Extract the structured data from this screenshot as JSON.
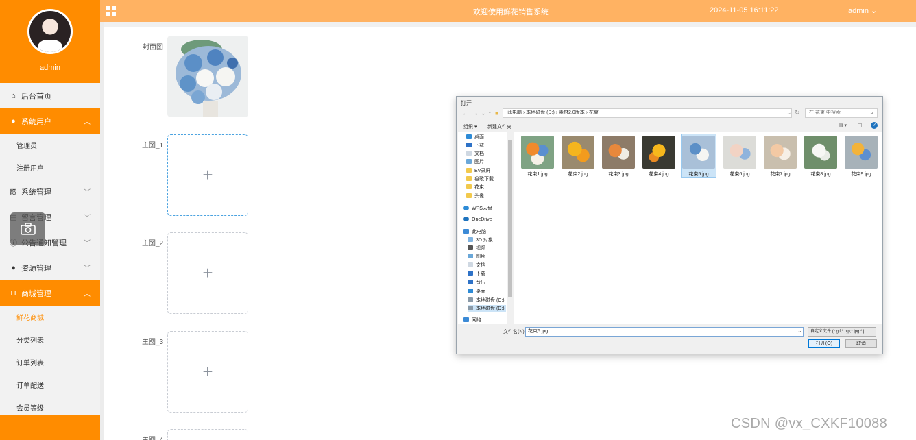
{
  "sidebar": {
    "username": "admin",
    "menu": {
      "home": "后台首页",
      "system_users": "系统用户",
      "admins": "管理员",
      "registered_users": "注册用户",
      "system_mgmt": "系统管理",
      "message_mgmt": "留言管理",
      "notice_mgmt": "公告通知管理",
      "resource_mgmt": "资源管理",
      "mall_mgmt": "商城管理",
      "flower_mall": "鲜花商城",
      "category_list": "分类列表",
      "order_list": "订单列表",
      "order_delivery": "订单配送",
      "member_level": "会员等级"
    }
  },
  "header": {
    "title": "欢迎使用鲜花销售系统",
    "datetime": "2024-11-05 16:11:22",
    "user": "admin"
  },
  "form": {
    "cover_label": "封面图",
    "main1_label": "主图_1",
    "main2_label": "主图_2",
    "main3_label": "主图_3",
    "main4_label": "主图_4",
    "plus": "+"
  },
  "dialog": {
    "title": "打开",
    "address": "此电脑 › 本地磁盘 (D:) › 素材2.0版本 › 花束",
    "search_placeholder": "在 花束 中搜索",
    "organize": "组织 ▾",
    "new_folder": "新建文件夹",
    "nav": {
      "desktop": "桌面",
      "downloads": "下载",
      "documents": "文档",
      "pictures": "图片",
      "ev_recordings": "EV录屏",
      "chrome_downloads": "谷歌下载",
      "bouquet": "花束",
      "avatar": "头像",
      "wps_cloud": "WPS云盘",
      "onedrive": "OneDrive",
      "this_pc": "此电脑",
      "objects_3d": "3D 对象",
      "videos": "视频",
      "pictures2": "图片",
      "documents2": "文档",
      "downloads2": "下载",
      "music": "音乐",
      "desktop2": "桌面",
      "disk_c": "本地磁盘 (C:)",
      "disk_d": "本地磁盘 (D:)",
      "network": "网络"
    },
    "files": [
      "花束1.jpg",
      "花束2.jpg",
      "花束3.jpg",
      "花束4.jpg",
      "花束5.jpg",
      "花束6.jpg",
      "花束7.jpg",
      "花束8.jpg",
      "花束9.jpg"
    ],
    "filename_label": "文件名(N):",
    "filename_value": "花束5.jpg",
    "filter": "自定义文件 (*.gif;*.pjp;*.jpg;*.j",
    "open_button": "打开(O)",
    "cancel_button": "取消"
  },
  "watermark": "CSDN @vx_CXKF10088",
  "colors": {
    "brand_orange": "#ff8c00",
    "header_orange": "#ffb262",
    "selection_blue": "#cce4f7"
  }
}
